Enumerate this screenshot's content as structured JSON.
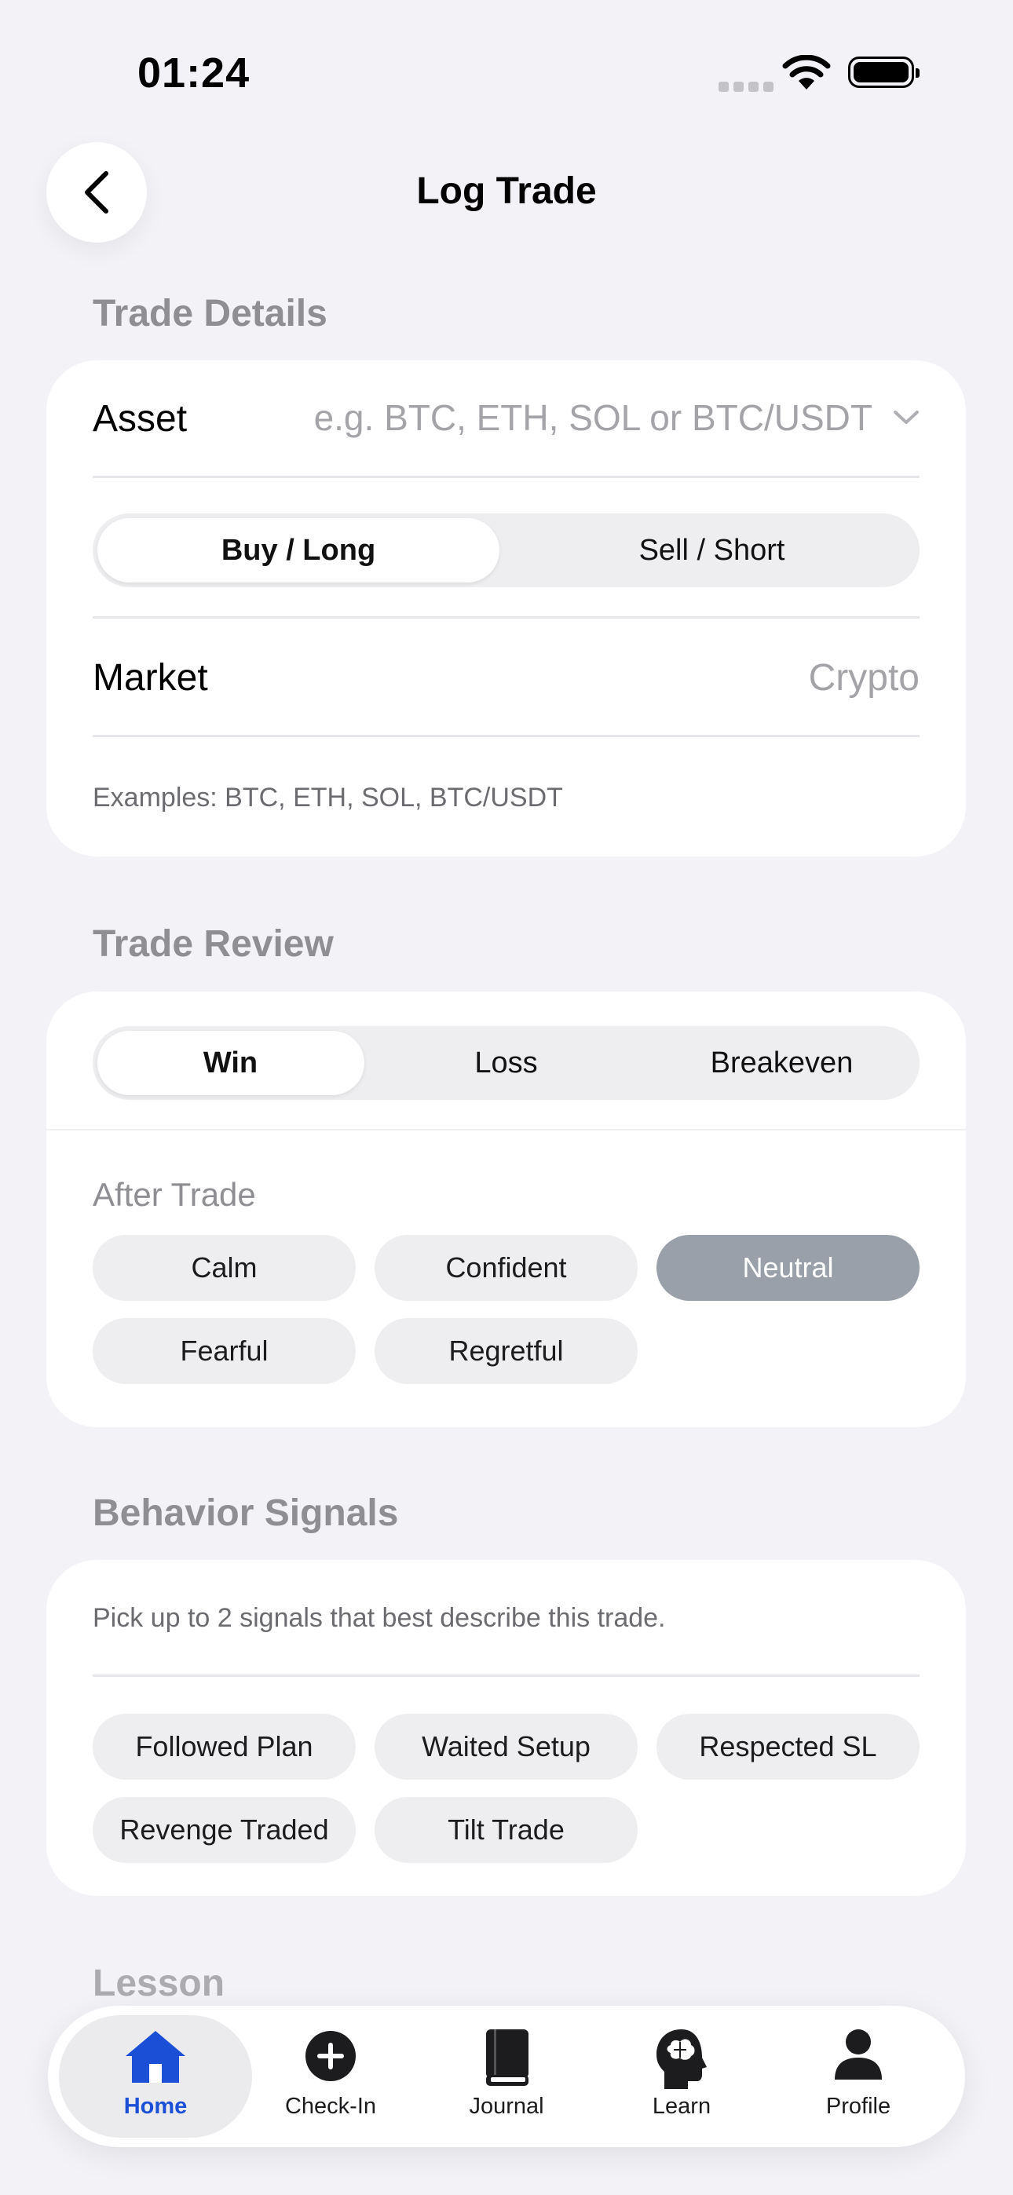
{
  "status_bar": {
    "time": "01:24"
  },
  "header": {
    "title": "Log Trade"
  },
  "trade_details": {
    "section_title": "Trade Details",
    "asset_label": "Asset",
    "asset_placeholder": "e.g. BTC, ETH, SOL or BTC/USDT",
    "direction_options": [
      "Buy / Long",
      "Sell / Short"
    ],
    "direction_selected": "Buy / Long",
    "market_label": "Market",
    "market_value": "Crypto",
    "helper": "Examples: BTC, ETH, SOL, BTC/USDT"
  },
  "trade_review": {
    "section_title": "Trade Review",
    "outcome_options": [
      "Win",
      "Loss",
      "Breakeven"
    ],
    "outcome_selected": "Win",
    "after_trade_label": "After Trade",
    "emotions": [
      "Calm",
      "Confident",
      "Neutral",
      "Fearful",
      "Regretful"
    ],
    "emotion_selected": "Neutral"
  },
  "behavior_signals": {
    "section_title": "Behavior Signals",
    "helper": "Pick up to 2 signals that best describe this trade.",
    "signals": [
      "Followed Plan",
      "Waited Setup",
      "Respected SL",
      "Revenge Traded",
      "Tilt Trade"
    ]
  },
  "lesson": {
    "section_title": "Lesson"
  },
  "tab_bar": {
    "items": [
      {
        "label": "Home",
        "icon": "home-icon"
      },
      {
        "label": "Check-In",
        "icon": "plus-circle-icon"
      },
      {
        "label": "Journal",
        "icon": "book-icon"
      },
      {
        "label": "Learn",
        "icon": "brain-head-icon"
      },
      {
        "label": "Profile",
        "icon": "person-icon"
      }
    ],
    "active": "Home"
  },
  "colors": {
    "accent": "#1a4fd6",
    "background": "#f2f2f7",
    "chip_selected": "#9aa0aa"
  }
}
